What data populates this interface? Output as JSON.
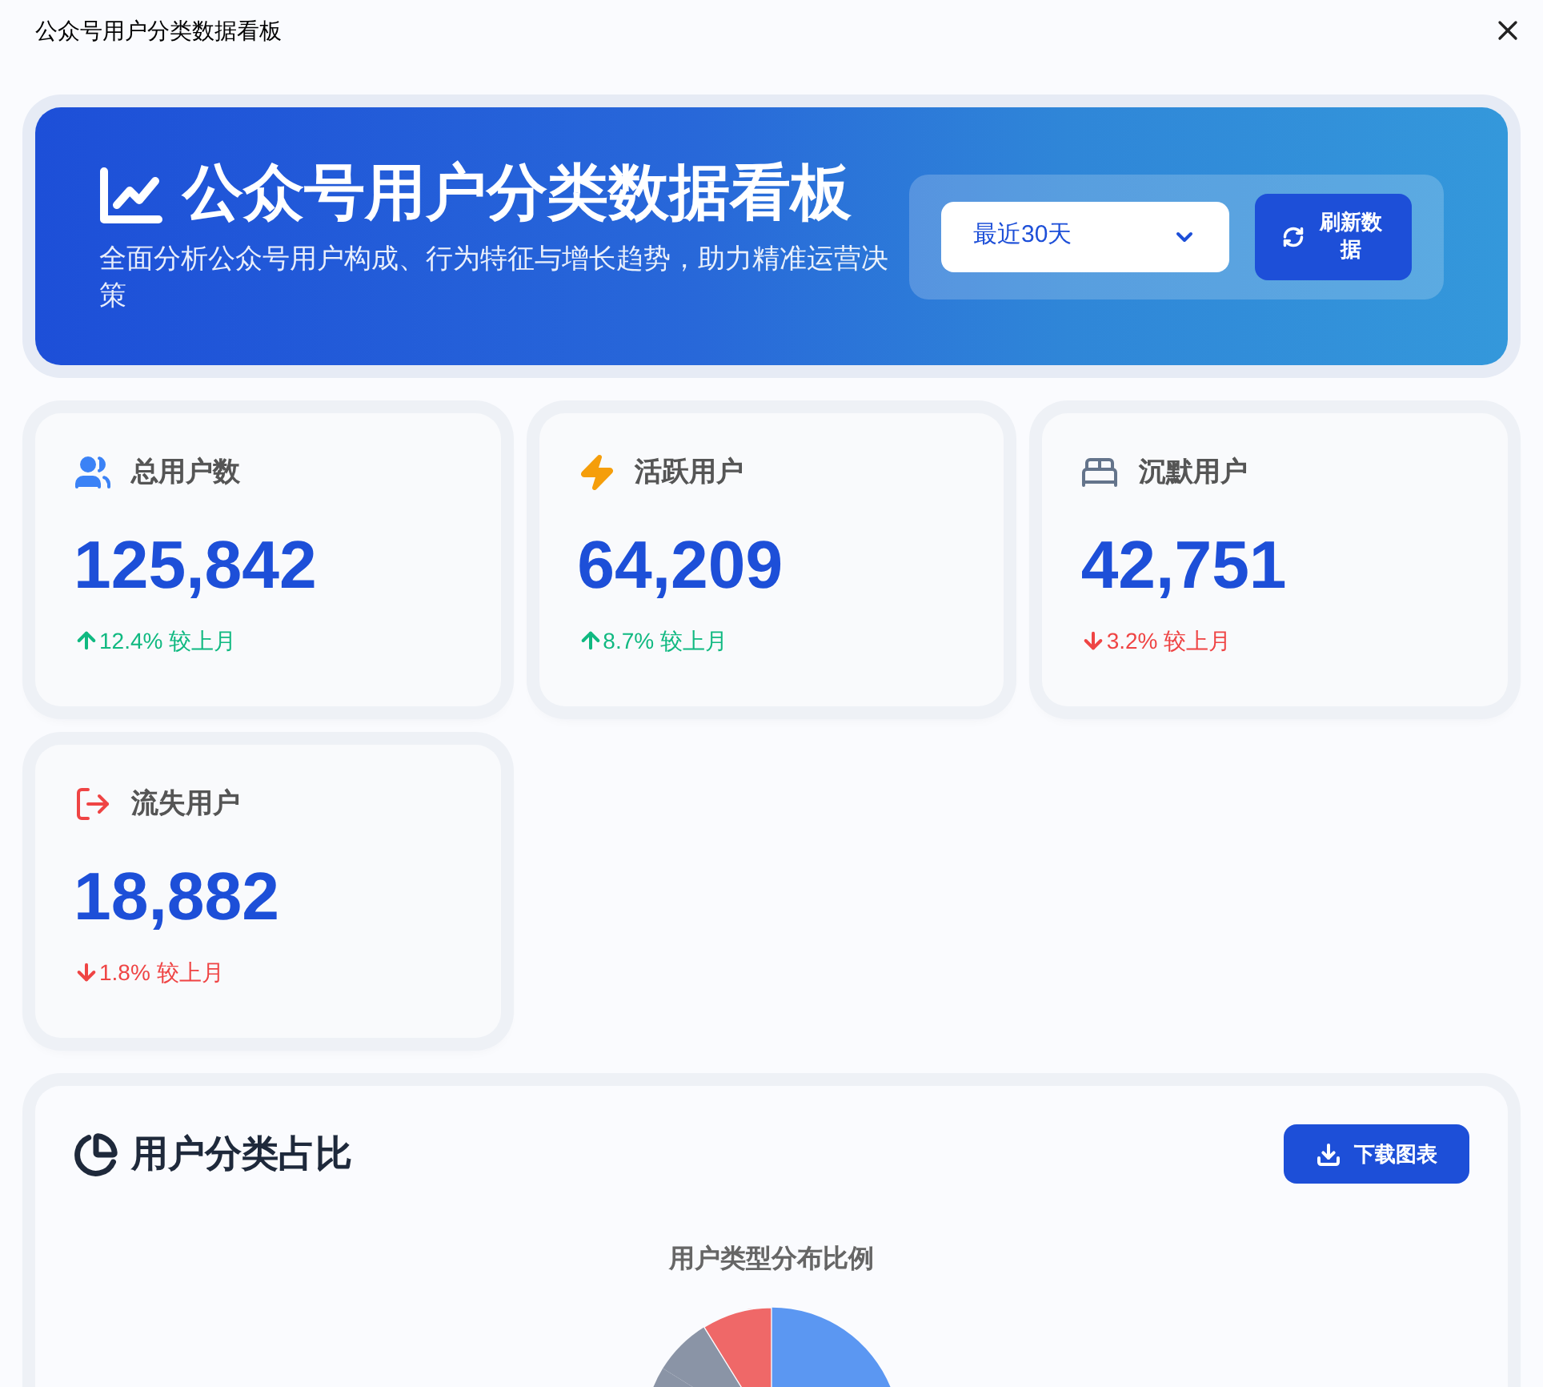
{
  "window": {
    "title": "公众号用户分类数据看板"
  },
  "header": {
    "title": "公众号用户分类数据看板",
    "subtitle": "全面分析公众号用户构成、行为特征与增长趋势，助力精准运营决策",
    "range_select": {
      "value": "最近30天"
    },
    "refresh_button": "刷新数据"
  },
  "stats": [
    {
      "kind": "total",
      "label": "总用户数",
      "value": "125,842",
      "rising": true,
      "change": "12.4% 较上月"
    },
    {
      "kind": "active",
      "label": "活跃用户",
      "value": "64,209",
      "rising": true,
      "change": "8.7% 较上月"
    },
    {
      "kind": "silent",
      "label": "沉默用户",
      "value": "42,751",
      "rising": false,
      "change": "3.2% 较上月"
    },
    {
      "kind": "lost",
      "label": "流失用户",
      "value": "18,882",
      "rising": false,
      "change": "1.8% 较上月"
    }
  ],
  "chart_panel": {
    "title": "用户分类占比",
    "download_button": "下载图表",
    "chart_title": "用户类型分布比例"
  }
}
